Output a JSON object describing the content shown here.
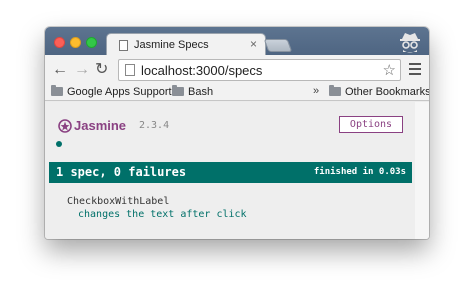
{
  "browser": {
    "tab_title": "Jasmine Specs",
    "tab_close_glyph": "×",
    "url": "localhost:3000/specs",
    "bookmarks": [
      "Google Apps Support",
      "Bash"
    ],
    "bookmarks_overflow": "»",
    "other_bookmarks": "Other Bookmarks",
    "icons": {
      "back": "arrow-left",
      "forward": "arrow-right",
      "reload": "reload",
      "star": "star-outline",
      "menu": "hamburger",
      "incognito": "incognito-spy"
    }
  },
  "jasmine": {
    "brand": "Jasmine",
    "version": "2.3.4",
    "options_label": "Options",
    "summary": "1 spec, 0 failures",
    "duration": "finished in 0.03s",
    "suites": [
      {
        "name": "CheckboxWithLabel",
        "specs": [
          "changes the text after click"
        ]
      }
    ],
    "colors": {
      "brand": "#8a4182",
      "passing": "#007069"
    }
  }
}
